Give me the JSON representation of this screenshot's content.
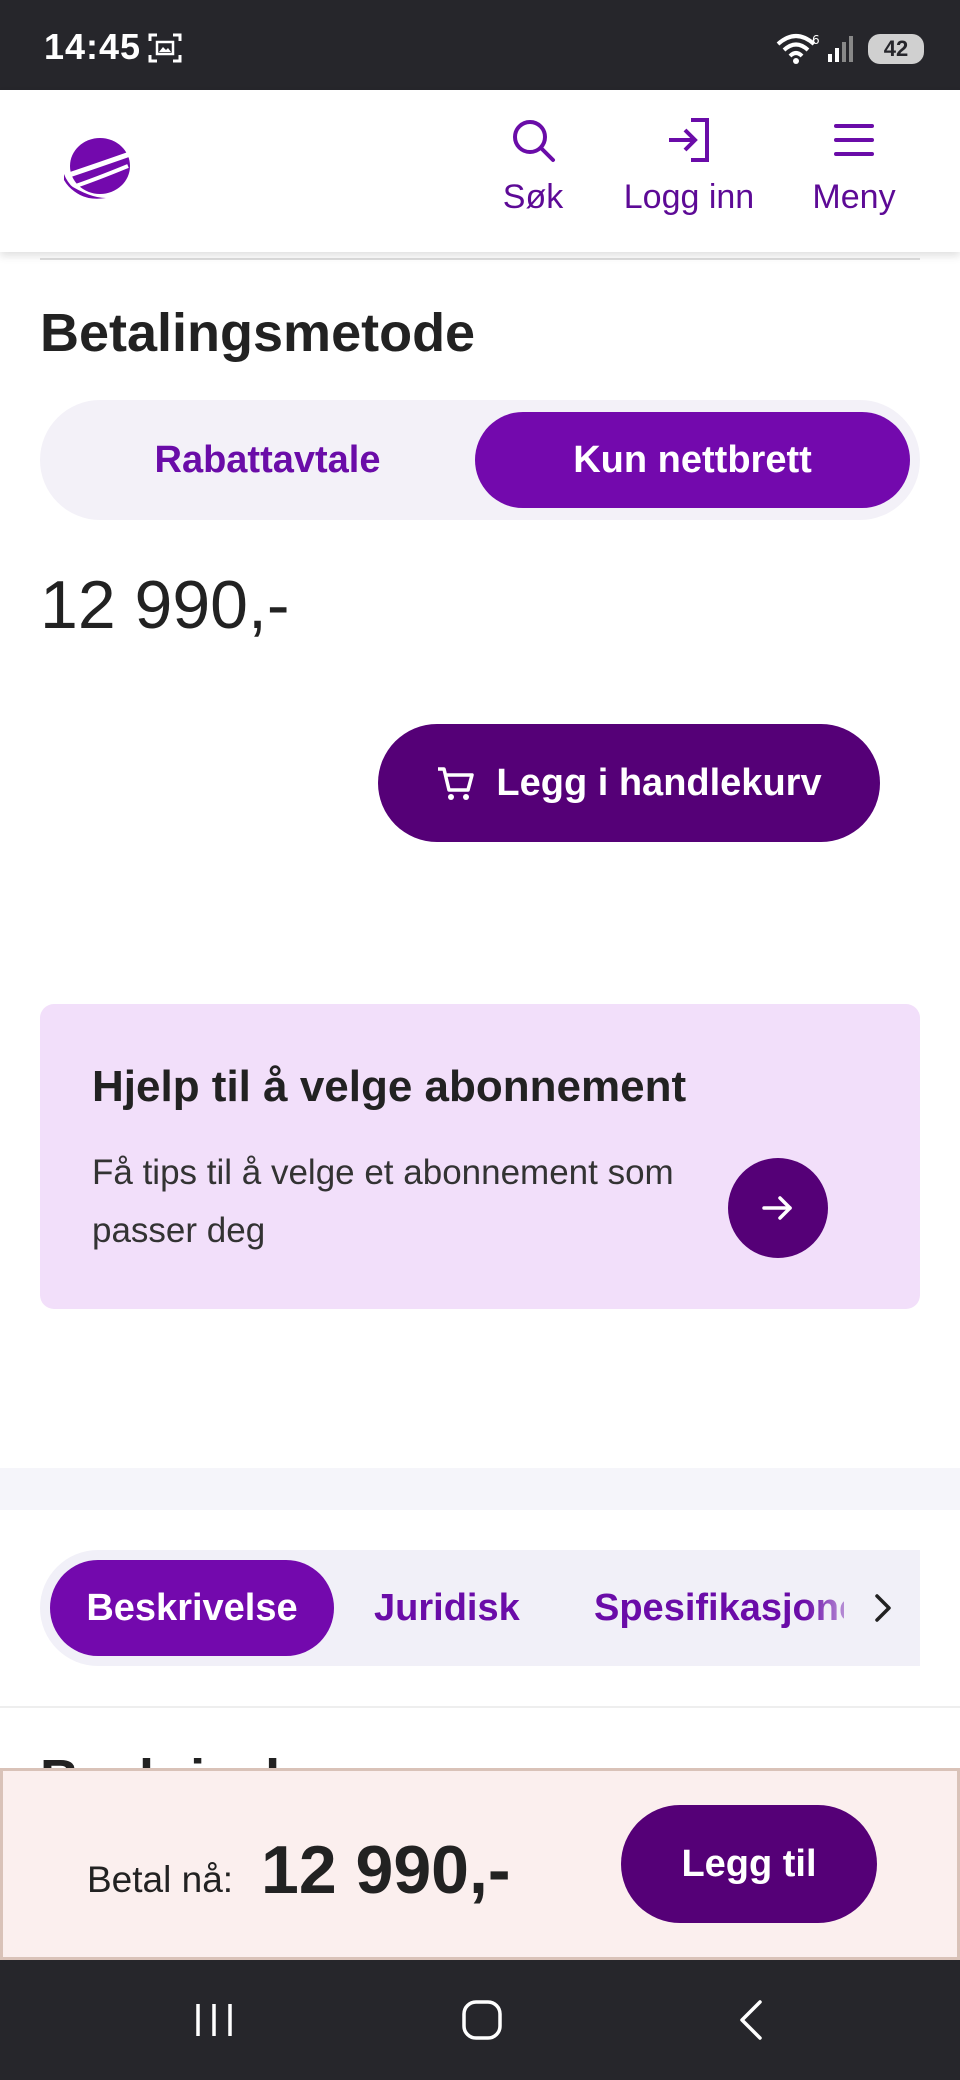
{
  "status_bar": {
    "time": "14:45",
    "battery": "42",
    "icons": [
      "screenshot-icon",
      "wifi-icon",
      "signal-icon"
    ]
  },
  "header": {
    "logo": "telia-logo",
    "nav": {
      "search_label": "Søk",
      "login_label": "Logg inn",
      "menu_label": "Meny"
    }
  },
  "payment": {
    "title": "Betalingsmetode",
    "options": {
      "discount": "Rabattavtale",
      "tablet_only": "Kun nettbrett"
    },
    "selected": "Kun nettbrett",
    "price": "12 990,-",
    "add_to_cart_label": "Legg i handlekurv"
  },
  "help_card": {
    "title": "Hjelp til å velge abonnement",
    "text": "Få tips til å velge et abonnement som passer deg"
  },
  "tabs": {
    "description": "Beskrivelse",
    "legal": "Juridisk",
    "specification": "Spesifikasjoner",
    "active": "Beskrivelse"
  },
  "peek_heading": "Beskrivelse",
  "pay_bar": {
    "label": "Betal nå:",
    "amount": "12 990,-",
    "button_label": "Legg til"
  },
  "colors": {
    "brand_purple": "#7309ad",
    "dark_purple": "#550077",
    "help_card_bg": "#f2dffa",
    "pay_bar_bg": "#fbefee"
  }
}
